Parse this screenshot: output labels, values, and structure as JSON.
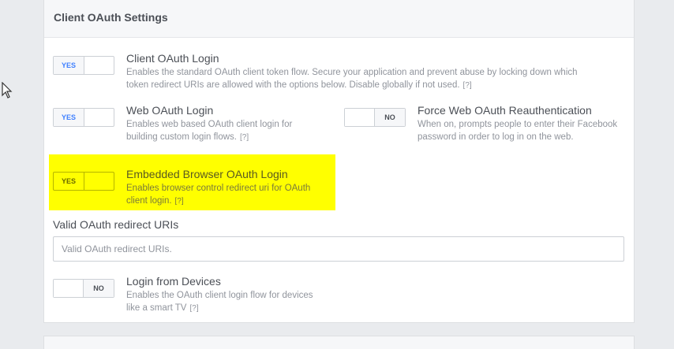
{
  "card": {
    "title": "Client OAuth Settings"
  },
  "settings": {
    "client_oauth_login": {
      "toggle_label": "YES",
      "title": "Client OAuth Login",
      "description": "Enables the standard OAuth client token flow. Secure your application and prevent abuse by locking down which token redirect URIs are allowed with the options below. Disable globally if not used.",
      "help": "[?]"
    },
    "web_oauth_login": {
      "toggle_label": "YES",
      "title": "Web OAuth Login",
      "description": "Enables web based OAuth client login for building custom login flows.",
      "help": "[?]"
    },
    "force_web_oauth_reauth": {
      "toggle_label": "NO",
      "title": "Force Web OAuth Reauthentication",
      "description": "When on, prompts people to enter their Facebook password in order to log in on the web.",
      "help": "[?]"
    },
    "embedded_browser_oauth_login": {
      "toggle_label": "YES",
      "title": "Embedded Browser OAuth Login",
      "description": "Enables browser control redirect uri for OAuth client login.",
      "help": "[?]"
    },
    "login_from_devices": {
      "toggle_label": "NO",
      "title": "Login from Devices",
      "description": "Enables the OAuth client login flow for devices like a smart TV",
      "help": "[?]"
    }
  },
  "redirect_uris": {
    "label": "Valid OAuth redirect URIs",
    "value": "",
    "placeholder": "Valid OAuth redirect URIs."
  },
  "colors": {
    "toggle_on_text": "#4080ff",
    "highlight": "#ffff00",
    "page_background": "#e9ebee"
  }
}
